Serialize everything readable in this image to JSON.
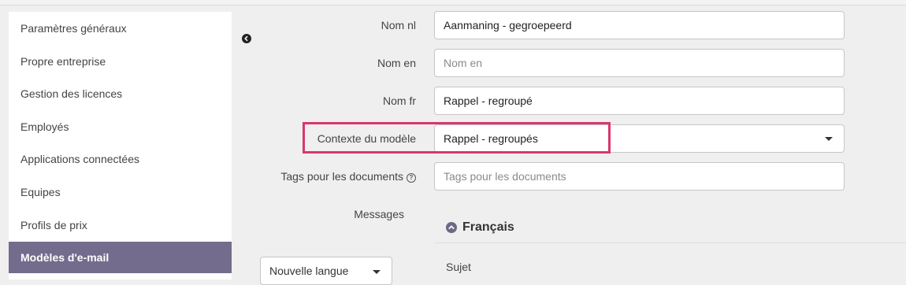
{
  "sidebar": {
    "items": [
      {
        "label": "Paramètres généraux"
      },
      {
        "label": "Propre entreprise"
      },
      {
        "label": "Gestion des licences"
      },
      {
        "label": "Employés"
      },
      {
        "label": "Applications connectées"
      },
      {
        "label": "Equipes"
      },
      {
        "label": "Profils de prix"
      },
      {
        "label": "Modèles d'e-mail",
        "active": true
      }
    ]
  },
  "form": {
    "name_nl": {
      "label": "Nom nl",
      "value": "Aanmaning - gegroepeerd"
    },
    "name_en": {
      "label": "Nom en",
      "value": "",
      "placeholder": "Nom en"
    },
    "name_fr": {
      "label": "Nom fr",
      "value": "Rappel - regroupé"
    },
    "context": {
      "label": "Contexte du modèle",
      "value": "Rappel - regroupés"
    },
    "tags": {
      "label": "Tags pour les documents",
      "placeholder": "Tags pour les documents",
      "help_icon": "question-circle-icon"
    },
    "messages": {
      "label": "Messages"
    }
  },
  "messages_section": {
    "language_heading": "Français",
    "subject_label": "Sujet",
    "new_language_select": "Nouvelle langue"
  },
  "colors": {
    "active_sidebar": "#746c8c",
    "highlight_border": "#d9376b"
  }
}
